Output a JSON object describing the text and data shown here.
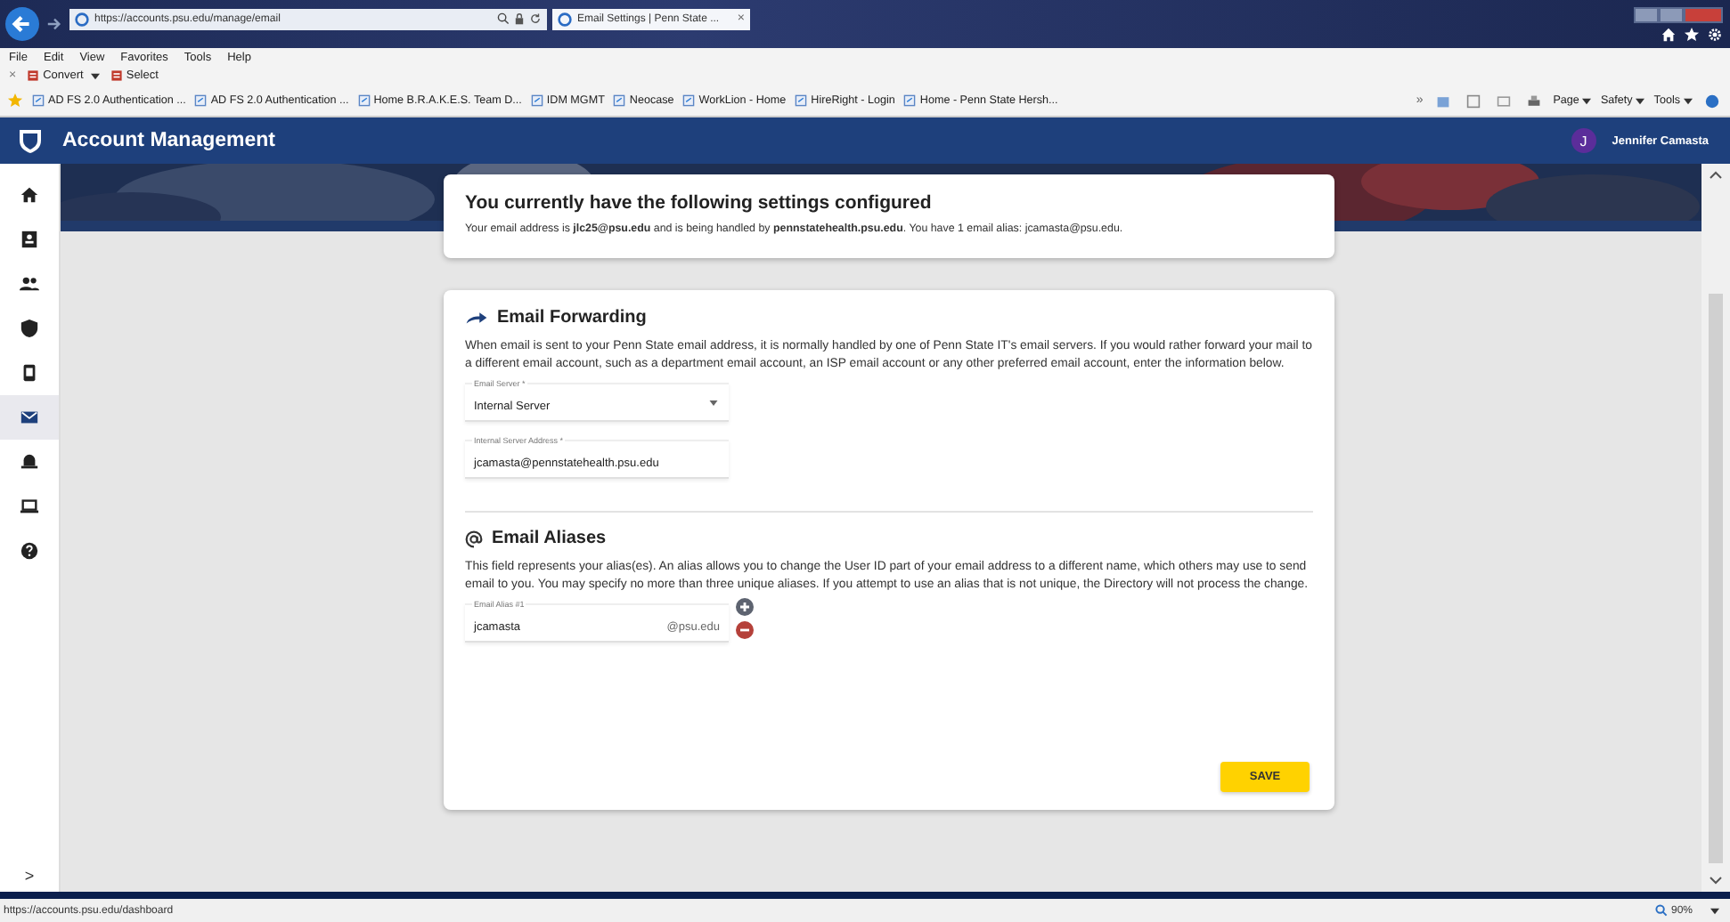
{
  "browser": {
    "address": "https://accounts.psu.edu/manage/email",
    "tab": {
      "title": "Email Settings | Penn State ...",
      "close": "×"
    },
    "menu": [
      "File",
      "Edit",
      "View",
      "Favorites",
      "Tools",
      "Help"
    ],
    "command_bar": {
      "close": "×",
      "items": [
        {
          "label": "Convert",
          "dropdown": true
        },
        {
          "label": "Select",
          "dropdown": false
        }
      ]
    },
    "favorites": [
      "AD FS 2.0 Authentication ...",
      "AD FS 2.0 Authentication ...",
      "Home B.R.A.K.E.S. Team D...",
      "IDM MGMT",
      "Neocase",
      "WorkLion - Home",
      "HireRight - Login",
      "Home - Penn State Hersh..."
    ],
    "overflow": "»",
    "tools": [
      "Page",
      "Safety",
      "Tools"
    ]
  },
  "app": {
    "title": "Account Management",
    "user": {
      "initial": "J",
      "name": "Jennifer Camasta"
    }
  },
  "sidebar": {
    "items": [
      {
        "selected": false
      },
      {
        "selected": false
      },
      {
        "selected": false
      },
      {
        "selected": false
      },
      {
        "selected": false
      },
      {
        "selected": true
      },
      {
        "selected": false
      },
      {
        "selected": false
      },
      {
        "selected": false
      }
    ],
    "expand": ">"
  },
  "summary": {
    "title": "You currently have the following settings configured",
    "text": "Your email address is **jlc25@psu.edu** and is being handled by **pennstatehealth.psu.edu**. You have 1 email alias: jcamasta@psu.edu."
  },
  "forwarding": {
    "title": "Email Forwarding",
    "text": "When email is sent to your Penn State email address, it is normally handled by one of Penn State IT's email servers. If you would rather forward your mail to a different email account, such as a department email account, an ISP email account or any other preferred email account, enter the information below.",
    "server": {
      "label": "Email Server *",
      "value": "Internal Server"
    },
    "address": {
      "label": "Internal Server Address *",
      "value": "jcamasta@pennstatehealth.psu.edu"
    }
  },
  "aliases": {
    "title": "Email Aliases",
    "text": "This field represents your alias(es). An alias allows you to change the User ID part of your email address to a different name, which others may use to send email to you. You may specify no more than three unique aliases. If you attempt to use an alias that is not unique, the Directory will not process the change.",
    "items": [
      {
        "label": "Email Alias #1",
        "value": "jcamasta",
        "suffix": "@psu.edu"
      }
    ],
    "save": "SAVE"
  },
  "status_bar": {
    "url": "https://accounts.psu.edu/dashboard",
    "zoom": "90%"
  }
}
